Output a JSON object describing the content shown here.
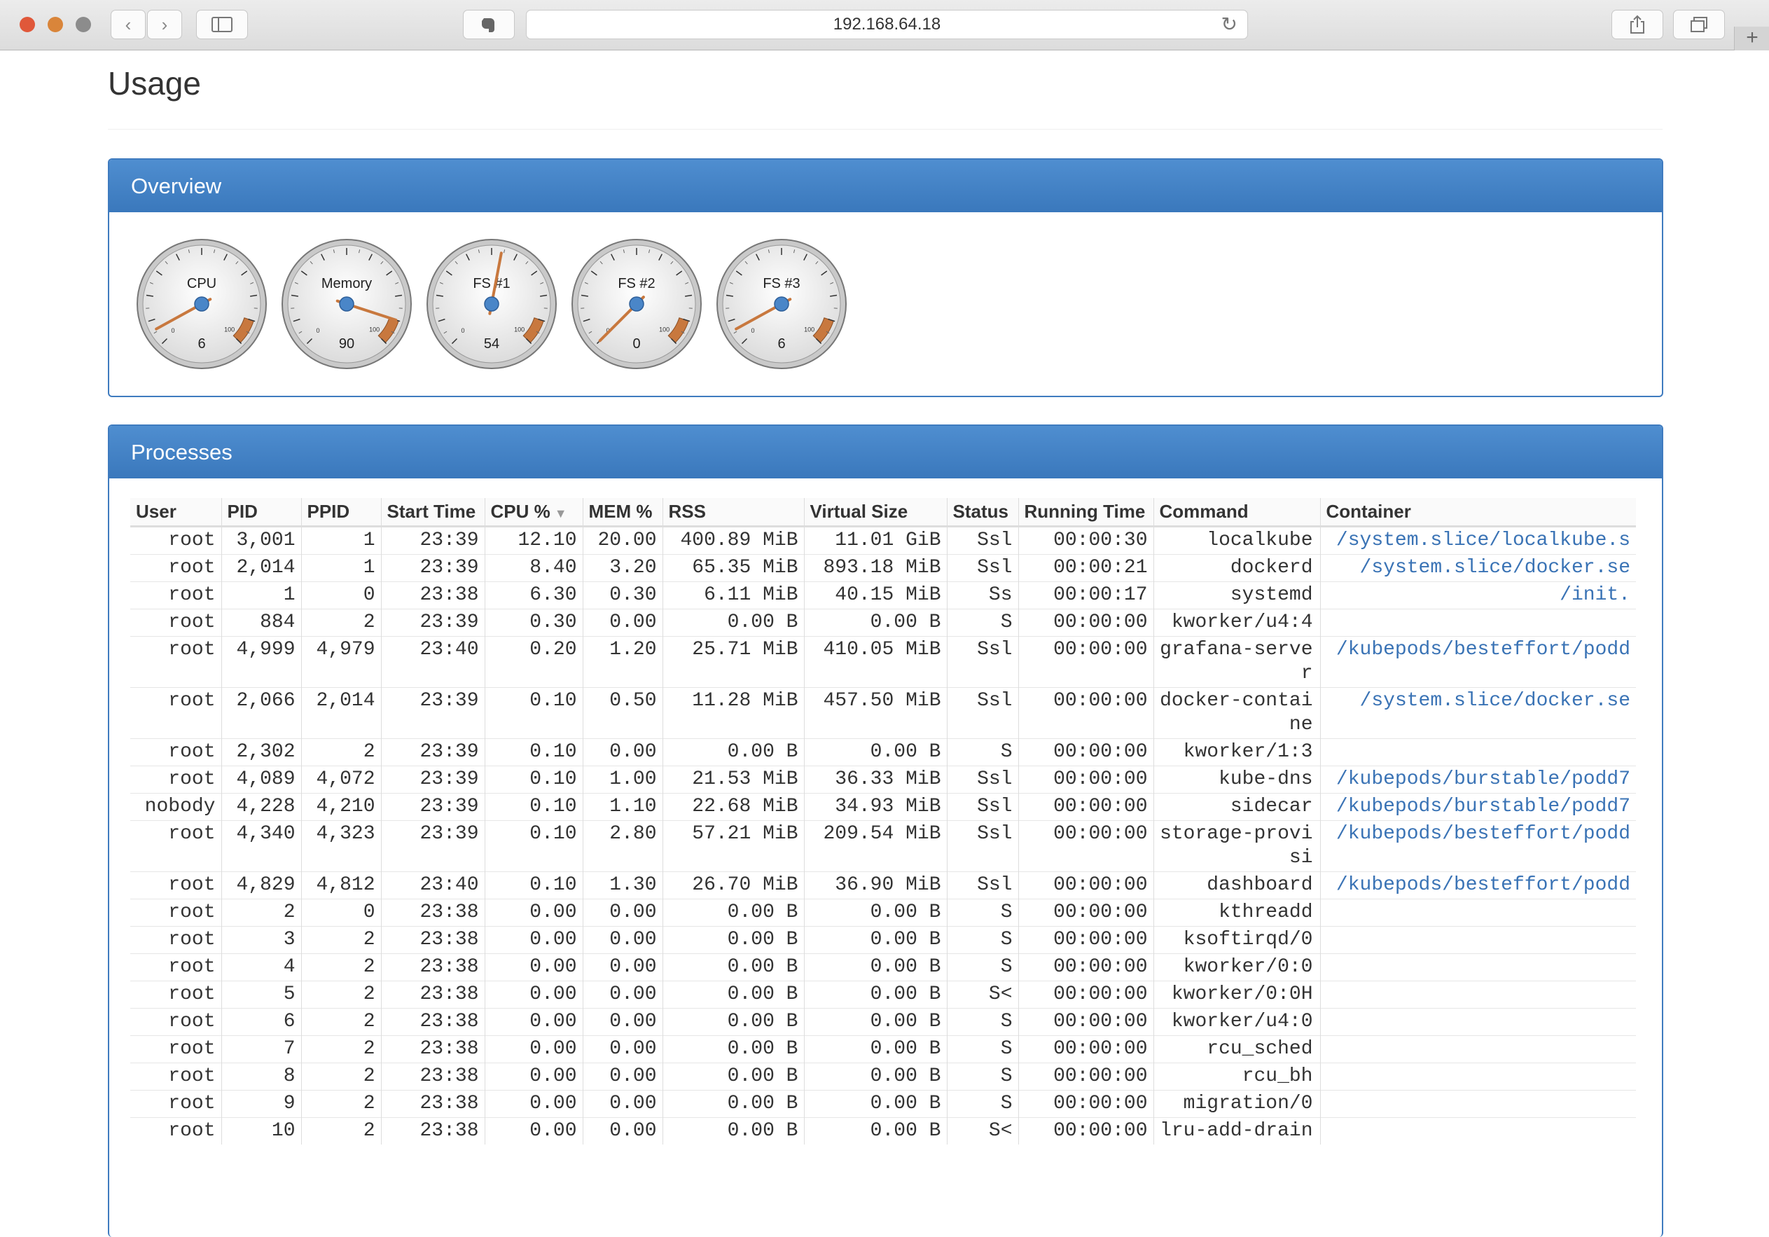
{
  "browser": {
    "url": "192.168.64.18"
  },
  "page": {
    "title": "Usage"
  },
  "overview": {
    "heading": "Overview",
    "gauges": [
      {
        "label": "CPU",
        "value": 6,
        "scale_min": "0",
        "scale_max": "100"
      },
      {
        "label": "Memory",
        "value": 90,
        "scale_min": "0",
        "scale_max": "100"
      },
      {
        "label": "FS #1",
        "value": 54,
        "scale_min": "0",
        "scale_max": "100"
      },
      {
        "label": "FS #2",
        "value": 0,
        "scale_min": "0",
        "scale_max": "100"
      },
      {
        "label": "FS #3",
        "value": 6,
        "scale_min": "0",
        "scale_max": "100"
      }
    ]
  },
  "processes": {
    "heading": "Processes",
    "columns": [
      "User",
      "PID",
      "PPID",
      "Start Time",
      "CPU %",
      "MEM %",
      "RSS",
      "Virtual Size",
      "Status",
      "Running Time",
      "Command",
      "Container"
    ],
    "sorted_column": "CPU %",
    "rows": [
      [
        "root",
        "3,001",
        "1",
        "23:39",
        "12.10",
        "20.00",
        "400.89 MiB",
        "11.01 GiB",
        "Ssl",
        "00:00:30",
        "localkube",
        "/system.slice/localkube.s"
      ],
      [
        "root",
        "2,014",
        "1",
        "23:39",
        "8.40",
        "3.20",
        "65.35 MiB",
        "893.18 MiB",
        "Ssl",
        "00:00:21",
        "dockerd",
        "/system.slice/docker.se"
      ],
      [
        "root",
        "1",
        "0",
        "23:38",
        "6.30",
        "0.30",
        "6.11 MiB",
        "40.15 MiB",
        "Ss",
        "00:00:17",
        "systemd",
        "/init."
      ],
      [
        "root",
        "884",
        "2",
        "23:39",
        "0.30",
        "0.00",
        "0.00 B",
        "0.00 B",
        "S",
        "00:00:00",
        "kworker/u4:4",
        ""
      ],
      [
        "root",
        "4,999",
        "4,979",
        "23:40",
        "0.20",
        "1.20",
        "25.71 MiB",
        "410.05 MiB",
        "Ssl",
        "00:00:00",
        "grafana-server",
        "/kubepods/besteffort/podd"
      ],
      [
        "root",
        "2,066",
        "2,014",
        "23:39",
        "0.10",
        "0.50",
        "11.28 MiB",
        "457.50 MiB",
        "Ssl",
        "00:00:00",
        "docker-containe",
        "/system.slice/docker.se"
      ],
      [
        "root",
        "2,302",
        "2",
        "23:39",
        "0.10",
        "0.00",
        "0.00 B",
        "0.00 B",
        "S",
        "00:00:00",
        "kworker/1:3",
        ""
      ],
      [
        "root",
        "4,089",
        "4,072",
        "23:39",
        "0.10",
        "1.00",
        "21.53 MiB",
        "36.33 MiB",
        "Ssl",
        "00:00:00",
        "kube-dns",
        "/kubepods/burstable/podd7"
      ],
      [
        "nobody",
        "4,228",
        "4,210",
        "23:39",
        "0.10",
        "1.10",
        "22.68 MiB",
        "34.93 MiB",
        "Ssl",
        "00:00:00",
        "sidecar",
        "/kubepods/burstable/podd7"
      ],
      [
        "root",
        "4,340",
        "4,323",
        "23:39",
        "0.10",
        "2.80",
        "57.21 MiB",
        "209.54 MiB",
        "Ssl",
        "00:00:00",
        "storage-provisi",
        "/kubepods/besteffort/podd"
      ],
      [
        "root",
        "4,829",
        "4,812",
        "23:40",
        "0.10",
        "1.30",
        "26.70 MiB",
        "36.90 MiB",
        "Ssl",
        "00:00:00",
        "dashboard",
        "/kubepods/besteffort/podd"
      ],
      [
        "root",
        "2",
        "0",
        "23:38",
        "0.00",
        "0.00",
        "0.00 B",
        "0.00 B",
        "S",
        "00:00:00",
        "kthreadd",
        ""
      ],
      [
        "root",
        "3",
        "2",
        "23:38",
        "0.00",
        "0.00",
        "0.00 B",
        "0.00 B",
        "S",
        "00:00:00",
        "ksoftirqd/0",
        ""
      ],
      [
        "root",
        "4",
        "2",
        "23:38",
        "0.00",
        "0.00",
        "0.00 B",
        "0.00 B",
        "S",
        "00:00:00",
        "kworker/0:0",
        ""
      ],
      [
        "root",
        "5",
        "2",
        "23:38",
        "0.00",
        "0.00",
        "0.00 B",
        "0.00 B",
        "S<",
        "00:00:00",
        "kworker/0:0H",
        ""
      ],
      [
        "root",
        "6",
        "2",
        "23:38",
        "0.00",
        "0.00",
        "0.00 B",
        "0.00 B",
        "S",
        "00:00:00",
        "kworker/u4:0",
        ""
      ],
      [
        "root",
        "7",
        "2",
        "23:38",
        "0.00",
        "0.00",
        "0.00 B",
        "0.00 B",
        "S",
        "00:00:00",
        "rcu_sched",
        ""
      ],
      [
        "root",
        "8",
        "2",
        "23:38",
        "0.00",
        "0.00",
        "0.00 B",
        "0.00 B",
        "S",
        "00:00:00",
        "rcu_bh",
        ""
      ],
      [
        "root",
        "9",
        "2",
        "23:38",
        "0.00",
        "0.00",
        "0.00 B",
        "0.00 B",
        "S",
        "00:00:00",
        "migration/0",
        ""
      ],
      [
        "root",
        "10",
        "2",
        "23:38",
        "0.00",
        "0.00",
        "0.00 B",
        "0.00 B",
        "S<",
        "00:00:00",
        "lru-add-drain",
        ""
      ]
    ]
  }
}
